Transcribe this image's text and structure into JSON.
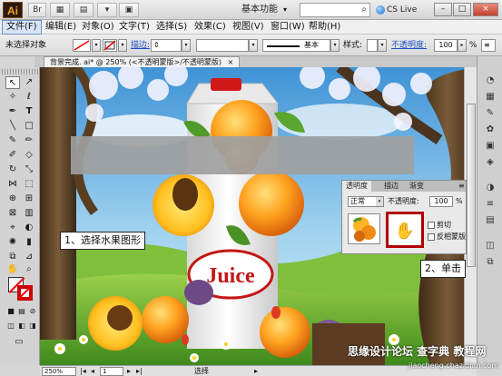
{
  "app": {
    "logo": "Ai",
    "badge": "Br"
  },
  "titlebar": {
    "workspace": "基本功能",
    "cs_live": "CS Live",
    "search_icon": "search-icon"
  },
  "menu": {
    "items": [
      "文件(F)",
      "编辑(E)",
      "对象(O)",
      "文字(T)",
      "选择(S)",
      "效果(C)",
      "视图(V)",
      "窗口(W)",
      "帮助(H)"
    ]
  },
  "control": {
    "no_selection": "未选择对象",
    "stroke_label": "描边:",
    "style_label": "样式:",
    "basic_label": "基本",
    "opacity_label": "不透明度:",
    "opacity_value": "100",
    "opacity_unit": "%"
  },
  "document": {
    "tab_title": "背景完成. ai* @ 250% (<不透明蒙版>/不透明蒙版)",
    "tab_close": "×"
  },
  "artwork": {
    "brand": "Juice"
  },
  "callouts": {
    "step1": "1、选择水果图形",
    "step2": "2、单击"
  },
  "transparency_panel": {
    "tabs": [
      "透明度",
      "描边",
      "渐变"
    ],
    "blend_mode": "正常",
    "opacity_label": "不透明度:",
    "opacity_value": "100",
    "opacity_unit": "%",
    "clip_label": "剪切",
    "invert_label": "反相蒙版"
  },
  "statusbar": {
    "zoom": "250%",
    "page": "1",
    "status_text": "选择"
  },
  "watermark": {
    "text": "思缘设计论坛 查字典 教程网",
    "url": "jiaocheng.chazidian.com"
  },
  "colors": {
    "accent": "#b00000",
    "link": "#1f4fc4"
  }
}
